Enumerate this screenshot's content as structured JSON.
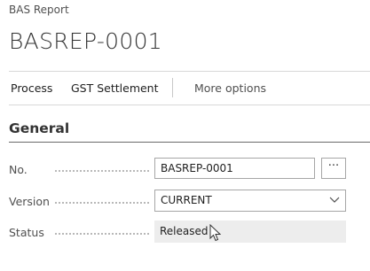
{
  "page": {
    "caption": "BAS Report",
    "title": "BASREP-0001"
  },
  "actions": {
    "process": "Process",
    "gst_settlement": "GST Settlement",
    "more_options": "More options"
  },
  "general": {
    "section_title": "General",
    "fields": {
      "no": {
        "label": "No.",
        "value": "BASREP-0001",
        "assist_label": "···"
      },
      "version": {
        "label": "Version",
        "value": "CURRENT",
        "icon": "chevron-down-icon"
      },
      "status": {
        "label": "Status",
        "value": "Released"
      }
    }
  },
  "colors": {
    "text": "#212121",
    "muted": "#505050",
    "readonly_bg": "#ededed",
    "border": "#a6a6a6"
  }
}
